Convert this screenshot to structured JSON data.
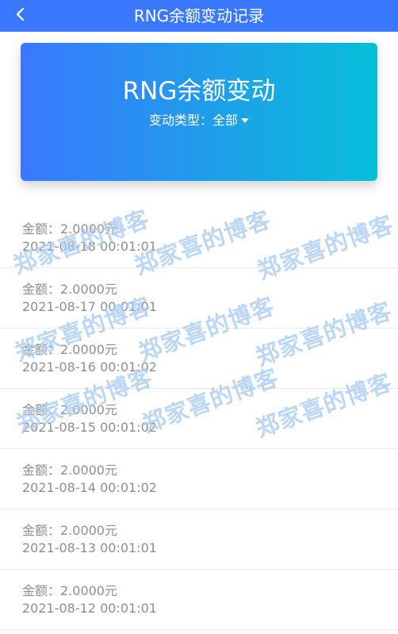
{
  "header": {
    "title": "RNG余额变动记录",
    "back_icon": "chevron-left-icon"
  },
  "card": {
    "title": "RNG余额变动",
    "filter_label": "变动类型：",
    "filter_value": "全部"
  },
  "records": [
    {
      "amount": "金额：2.0000元",
      "time": "2021-08-18 00:01:01"
    },
    {
      "amount": "金额：2.0000元",
      "time": "2021-08-17 00:01:01"
    },
    {
      "amount": "金额：2.0000元",
      "time": "2021-08-16 00:01:02"
    },
    {
      "amount": "金额：2.0000元",
      "time": "2021-08-15 00:01:02"
    },
    {
      "amount": "金额：2.0000元",
      "time": "2021-08-14 00:01:02"
    },
    {
      "amount": "金额：2.0000元",
      "time": "2021-08-13 00:01:01"
    },
    {
      "amount": "金额：2.0000元",
      "time": "2021-08-12 00:01:01"
    }
  ],
  "watermark": {
    "text": "郑家喜的博客"
  },
  "colors": {
    "header_bg": "#3a78ff",
    "card_gradient_start": "#3a78ff",
    "card_gradient_end": "#07bfd7",
    "record_text": "#8f8f8f"
  }
}
